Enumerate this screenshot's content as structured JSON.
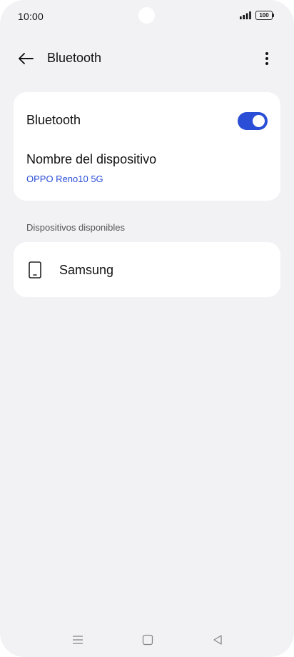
{
  "status_bar": {
    "time": "10:00",
    "battery": "100",
    "icons": [
      "signal-icon",
      "battery-icon"
    ]
  },
  "header": {
    "title": "Bluetooth",
    "back_icon": "arrow-left-icon",
    "more_icon": "more-vertical-icon"
  },
  "bluetooth_card": {
    "toggle_label": "Bluetooth",
    "toggle_on": true,
    "device_name_label": "Nombre del dispositivo",
    "device_name_value": "OPPO Reno10 5G"
  },
  "available_devices": {
    "section_label": "Dispositivos disponibles",
    "items": [
      {
        "label": "Samsung",
        "icon": "phone-icon"
      }
    ]
  },
  "nav_bar": {
    "icons": [
      "menu-icon",
      "home-square-icon",
      "back-triangle-icon"
    ]
  },
  "colors": {
    "accent": "#2a4ed6",
    "background": "#f2f2f4",
    "card": "#ffffff",
    "text": "#111111"
  }
}
